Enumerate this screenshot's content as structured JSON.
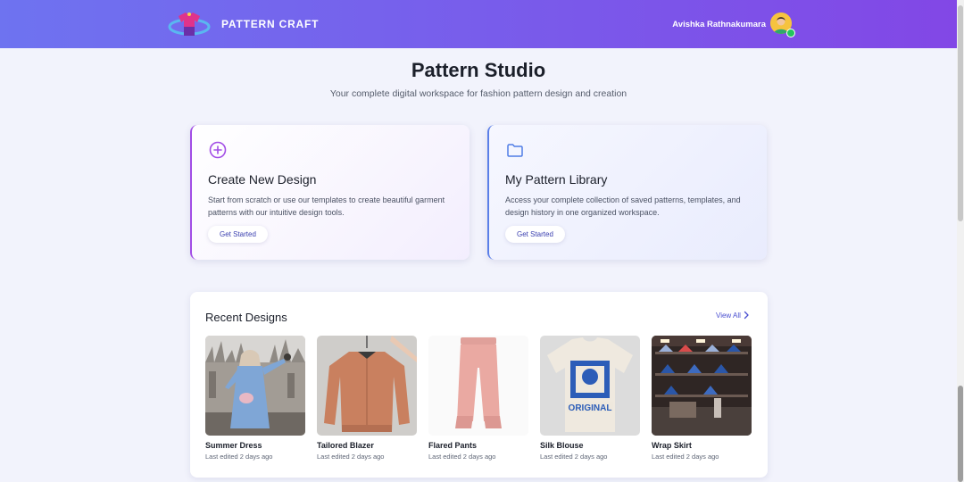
{
  "header": {
    "brand": "PATTERN CRAFT",
    "user_name": "Avishka Rathnakumara",
    "logo_icon": "hanger-shirt-logo-icon",
    "avatar_icon": "user-avatar-icon"
  },
  "hero": {
    "title": "Pattern Studio",
    "subtitle": "Your complete digital workspace for fashion pattern design and creation"
  },
  "cards": [
    {
      "icon": "plus-circle-icon",
      "title": "Create New Design",
      "description": "Start from scratch or use our templates to create beautiful garment patterns with our intuitive design tools.",
      "button": "Get Started",
      "accent": "#a24ee6"
    },
    {
      "icon": "folder-icon",
      "title": "My Pattern Library",
      "description": "Access your complete collection of saved patterns, templates, and design history in one organized workspace.",
      "button": "Get Started",
      "accent": "#5b7fe8"
    }
  ],
  "recent": {
    "title": "Recent Designs",
    "view_all": "View All",
    "items": [
      {
        "name": "Summer Dress",
        "meta": "Last edited 2 days ago",
        "image": "woman-blue-coat-photo"
      },
      {
        "name": "Tailored Blazer",
        "meta": "Last edited 2 days ago",
        "image": "peach-bomber-jacket-photo"
      },
      {
        "name": "Flared Pants",
        "meta": "Last edited 2 days ago",
        "image": "pink-joggers-photo"
      },
      {
        "name": "Silk Blouse",
        "meta": "Last edited 2 days ago",
        "image": "graphic-tshirt-photo"
      },
      {
        "name": "Wrap Skirt",
        "meta": "Last edited 2 days ago",
        "image": "clothing-store-shelves-photo"
      }
    ]
  },
  "colors": {
    "header_gradient_start": "#6e73f0",
    "header_gradient_end": "#8247e6",
    "page_background": "#f2f3fc",
    "online_status": "#22c55e"
  }
}
